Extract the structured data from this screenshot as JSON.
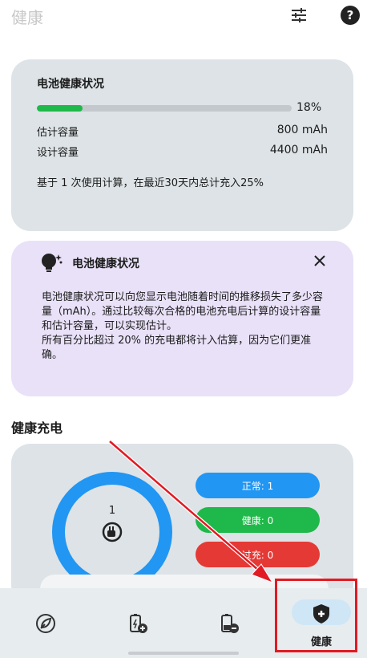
{
  "header": {
    "title": "健康"
  },
  "battery_health": {
    "title": "电池健康状况",
    "progress_percent": 18,
    "progress_label": "18%",
    "progress_color": "#1fb84a",
    "estimated_label": "估计容量",
    "estimated_value": "800 mAh",
    "design_label": "设计容量",
    "design_value": "4400 mAh",
    "basis_text": "基于 1 次使用计算，在最近30天内总计充入25%"
  },
  "info_card": {
    "title": "电池健康状况",
    "close_icon": "close-icon",
    "body": "电池健康状况可以向您显示电池随着时间的推移损失了多少容量（mAh）。通过比较每次合格的电池充电后计算的设计容量和估计容量，可以实现估计。\n所有百分比超过 20% 的充电都将计入估算，因为它们更准确。"
  },
  "healthy_charging": {
    "section_title": "健康充电",
    "ring_count": "1",
    "ring_color": "#2196f3",
    "pills": {
      "normal": "正常: 1",
      "good": "健康: 0",
      "over": "过充: 0"
    }
  },
  "bottom_nav": {
    "items": [
      {
        "icon": "leaf-icon",
        "label": ""
      },
      {
        "icon": "battery-plus-icon",
        "label": ""
      },
      {
        "icon": "battery-minus-icon",
        "label": ""
      },
      {
        "icon": "shield-plus-icon",
        "label": "健康",
        "active": true
      }
    ]
  },
  "colors": {
    "accent_blue": "#2196f3",
    "accent_green": "#1fb84a",
    "accent_red": "#e53935",
    "highlight_red": "#e01b24"
  }
}
